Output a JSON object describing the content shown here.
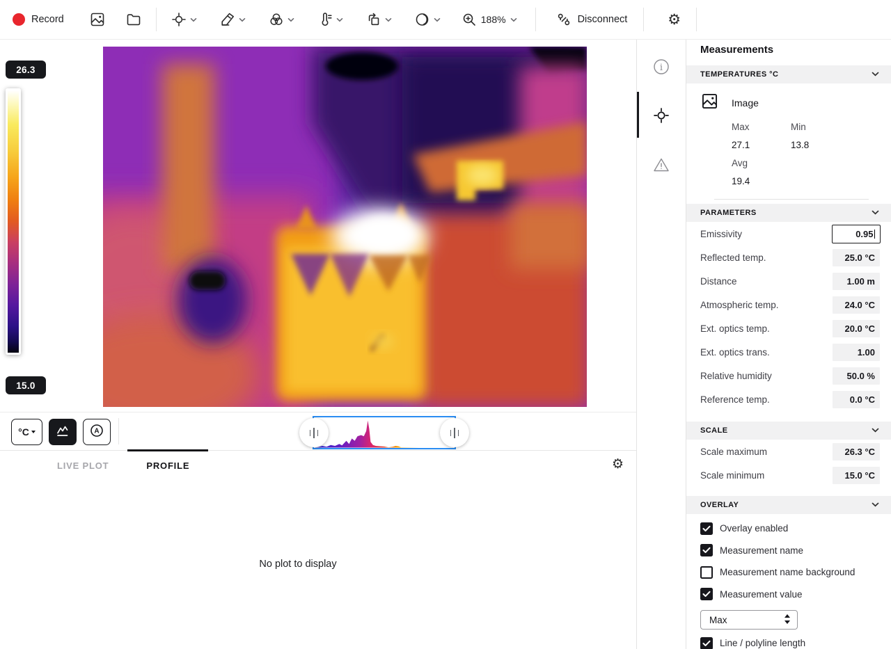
{
  "toolbar": {
    "record_label": "Record",
    "zoom_level": "188%",
    "disconnect_label": "Disconnect"
  },
  "scale_bar": {
    "max": "26.3",
    "min": "15.0"
  },
  "viewer_controls": {
    "unit": "°C",
    "auto_label": "A"
  },
  "plot_panel": {
    "tabs": [
      {
        "label": "LIVE PLOT",
        "active": false
      },
      {
        "label": "PROFILE",
        "active": true
      }
    ],
    "empty_message": "No plot to display"
  },
  "sidebar": {
    "title": "Measurements",
    "temperatures": {
      "header": "TEMPERATURES °C",
      "item_label": "Image",
      "stats": [
        {
          "label": "Max",
          "value": "27.1"
        },
        {
          "label": "Min",
          "value": "13.8"
        },
        {
          "label": "Avg",
          "value": "19.4"
        }
      ]
    },
    "parameters": {
      "header": "PARAMETERS",
      "rows": [
        {
          "label": "Emissivity",
          "value": "0.95"
        },
        {
          "label": "Reflected temp.",
          "value": "25.0 °C"
        },
        {
          "label": "Distance",
          "value": "1.00 m"
        },
        {
          "label": "Atmospheric temp.",
          "value": "24.0 °C"
        },
        {
          "label": "Ext. optics temp.",
          "value": "20.0 °C"
        },
        {
          "label": "Ext. optics trans.",
          "value": "1.00"
        },
        {
          "label": "Relative humidity",
          "value": "50.0 %"
        },
        {
          "label": "Reference temp.",
          "value": "0.0 °C"
        }
      ]
    },
    "scale": {
      "header": "SCALE",
      "rows": [
        {
          "label": "Scale maximum",
          "value": "26.3 °C"
        },
        {
          "label": "Scale minimum",
          "value": "15.0 °C"
        }
      ]
    },
    "overlay": {
      "header": "OVERLAY",
      "checkboxes": [
        {
          "label": "Overlay enabled",
          "checked": true
        },
        {
          "label": "Measurement name",
          "checked": true
        },
        {
          "label": "Measurement name background",
          "checked": false
        },
        {
          "label": "Measurement value",
          "checked": true
        }
      ],
      "value_select": "Max",
      "extra_checkbox": {
        "label": "Line / polyline length",
        "checked": true
      }
    }
  },
  "histogram": {
    "points": [
      [
        0,
        0
      ],
      [
        0.03,
        0.02
      ],
      [
        0.06,
        0.06
      ],
      [
        0.09,
        0.03
      ],
      [
        0.12,
        0.09
      ],
      [
        0.15,
        0.06
      ],
      [
        0.18,
        0.13
      ],
      [
        0.2,
        0.08
      ],
      [
        0.23,
        0.24
      ],
      [
        0.25,
        0.13
      ],
      [
        0.27,
        0.32
      ],
      [
        0.29,
        0.24
      ],
      [
        0.31,
        0.4
      ],
      [
        0.335,
        0.44
      ],
      [
        0.355,
        0.4
      ],
      [
        0.372,
        0.58
      ],
      [
        0.383,
        0.95
      ],
      [
        0.393,
        0.66
      ],
      [
        0.403,
        0.2
      ],
      [
        0.42,
        0.09
      ],
      [
        0.44,
        0.06
      ],
      [
        0.47,
        0.05
      ],
      [
        0.5,
        0.04
      ],
      [
        0.53,
        0.01
      ],
      [
        0.56,
        0.03
      ],
      [
        0.58,
        0.06
      ],
      [
        0.6,
        0.05
      ],
      [
        0.62,
        0.01
      ],
      [
        0.75,
        0
      ],
      [
        1,
        0
      ]
    ]
  },
  "colors": {
    "record_red": "#e8262d",
    "histogram_box_blue": "#2b8df2",
    "checkbox_black": "#17171c",
    "badge_black": "#17181c"
  }
}
